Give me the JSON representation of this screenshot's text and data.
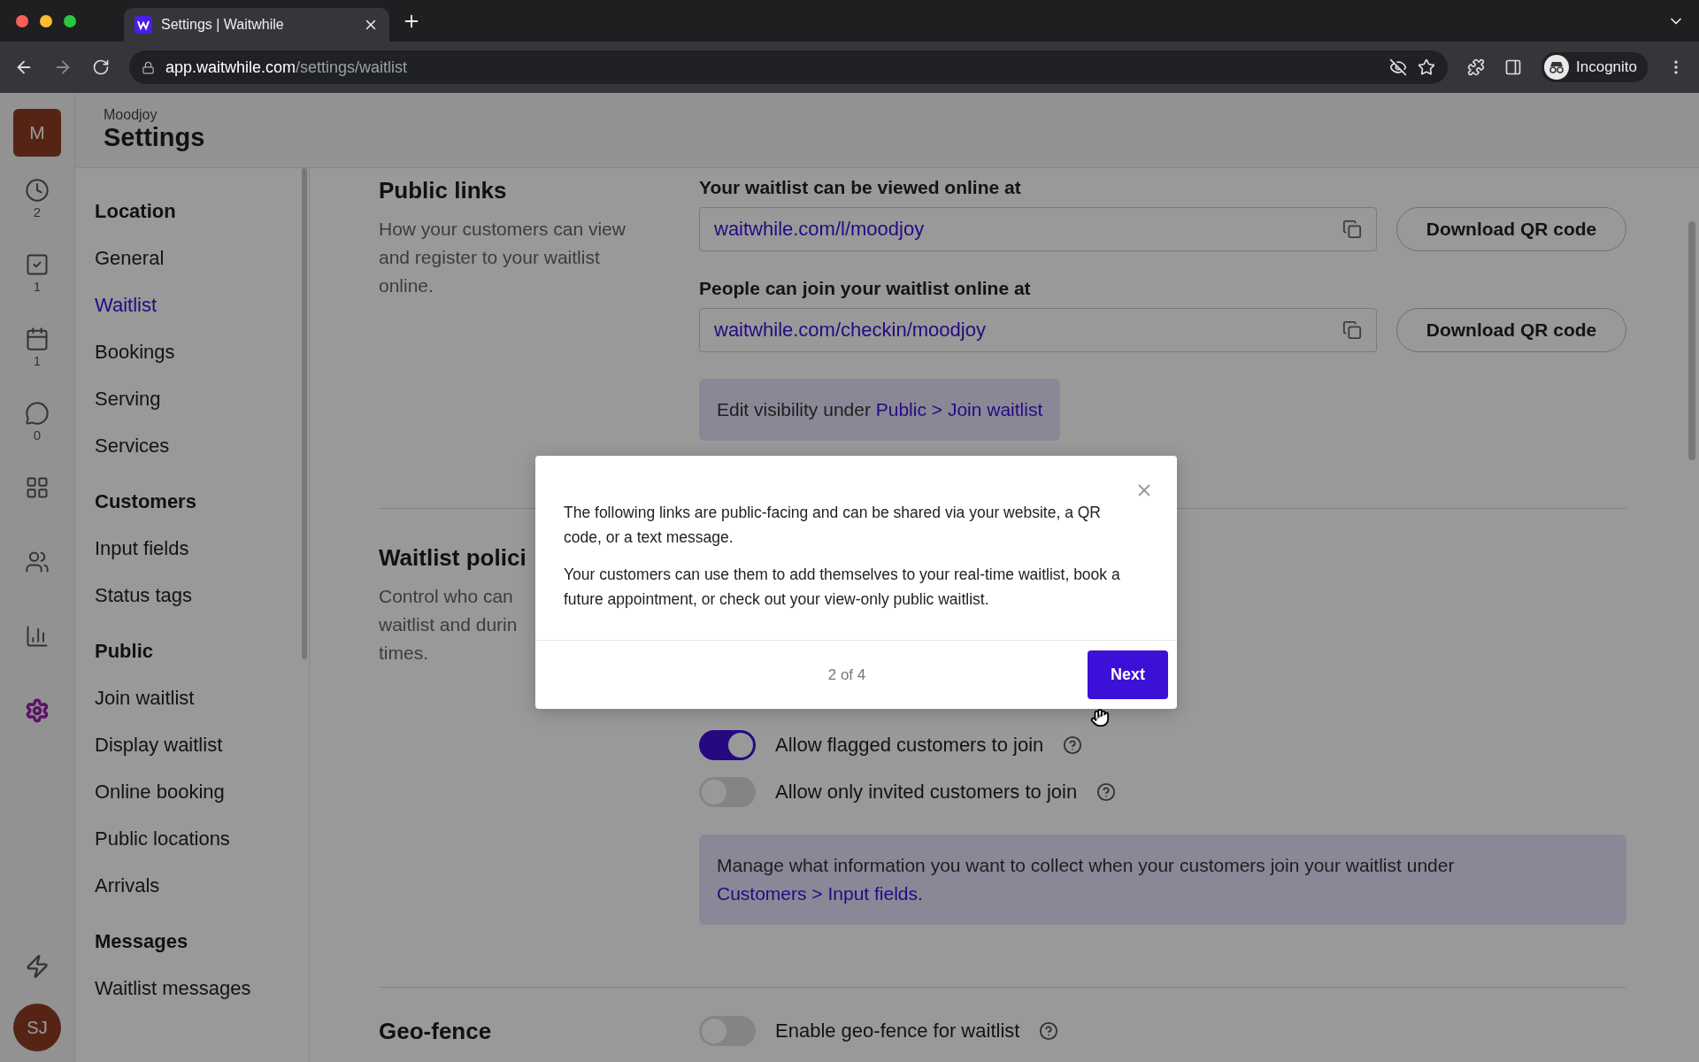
{
  "browser": {
    "tab_title": "Settings | Waitwhile",
    "url_host": "app.waitwhile.com",
    "url_path": "/settings/waitlist",
    "profile": "Incognito"
  },
  "rail": {
    "badge": "M",
    "items": [
      {
        "kind": "clock",
        "count": "2",
        "selected": false
      },
      {
        "kind": "check",
        "count": "1",
        "selected": false
      },
      {
        "kind": "calendar",
        "count": "1",
        "selected": false
      },
      {
        "kind": "chat",
        "count": "0",
        "selected": false
      },
      {
        "kind": "grid",
        "selected": false
      },
      {
        "kind": "users",
        "selected": false
      },
      {
        "kind": "chart",
        "selected": false
      },
      {
        "kind": "settings",
        "selected": true
      }
    ],
    "user": "SJ"
  },
  "header": {
    "org": "Moodjoy",
    "title": "Settings"
  },
  "sidebar": {
    "groups": [
      {
        "title": "Location",
        "items": [
          {
            "label": "General",
            "selected": false
          },
          {
            "label": "Waitlist",
            "selected": true
          },
          {
            "label": "Bookings",
            "selected": false
          },
          {
            "label": "Serving",
            "selected": false
          },
          {
            "label": "Services",
            "selected": false
          }
        ]
      },
      {
        "title": "Customers",
        "items": [
          {
            "label": "Input fields",
            "selected": false
          },
          {
            "label": "Status tags",
            "selected": false
          }
        ]
      },
      {
        "title": "Public",
        "items": [
          {
            "label": "Join waitlist",
            "selected": false
          },
          {
            "label": "Display waitlist",
            "selected": false
          },
          {
            "label": "Online booking",
            "selected": false
          },
          {
            "label": "Public locations",
            "selected": false
          },
          {
            "label": "Arrivals",
            "selected": false
          }
        ]
      },
      {
        "title": "Messages",
        "items": [
          {
            "label": "Waitlist messages",
            "selected": false
          }
        ]
      }
    ]
  },
  "public_links": {
    "title": "Public links",
    "description": "How your customers can view and register to your waitlist online.",
    "fields": [
      {
        "label": "Your waitlist can be viewed online at",
        "value": "waitwhile.com/l/moodjoy",
        "button": "Download QR code"
      },
      {
        "label": "People can join your waitlist online at",
        "value": "waitwhile.com/checkin/moodjoy",
        "button": "Download QR code"
      }
    ],
    "note": {
      "text": "Edit visibility under ",
      "link": "Public > Join waitlist"
    }
  },
  "waitlist_policies": {
    "title": "Waitlist polici",
    "description_lines": [
      "Control who can",
      "waitlist and durin",
      "times."
    ],
    "toggles": [
      {
        "label": "Allow flagged customers to join",
        "on": true
      },
      {
        "label": "Allow only invited customers to join",
        "on": false
      }
    ],
    "note": {
      "text": "Manage what information you want to collect when your customers join your waitlist under ",
      "link": "Customers > Input fields."
    }
  },
  "geo_fence": {
    "title": "Geo-fence",
    "toggle": {
      "label": "Enable geo-fence for waitlist",
      "on": false
    }
  },
  "modal": {
    "paragraphs": [
      "The following links are public-facing and can be shared via your website, a QR code, or a text message.",
      "Your customers can use them to add themselves to your real-time waitlist, book a future appointment, or check out your view-only public waitlist."
    ],
    "step": "2 of 4",
    "button": "Next"
  }
}
